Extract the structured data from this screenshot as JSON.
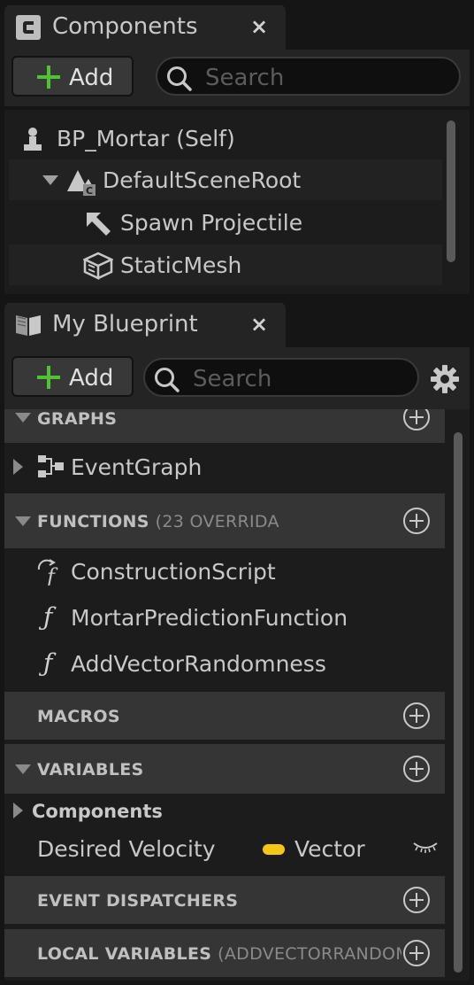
{
  "components_panel": {
    "tab_title": "Components",
    "close_glyph": "×",
    "add_label": "Add",
    "search_placeholder": "Search",
    "tree": [
      {
        "label": "BP_Mortar (Self)",
        "icon": "pawn-icon"
      },
      {
        "label": "DefaultSceneRoot",
        "icon": "scene-root-icon",
        "expanded": true
      },
      {
        "label": "Spawn Projectile",
        "icon": "arrow-component-icon"
      },
      {
        "label": "StaticMesh",
        "icon": "static-mesh-icon"
      }
    ]
  },
  "blueprint_panel": {
    "tab_title": "My Blueprint",
    "close_glyph": "×",
    "add_label": "Add",
    "search_placeholder": "Search",
    "sections": {
      "graphs": {
        "title": "GRAPHS",
        "items": [
          "EventGraph"
        ]
      },
      "functions": {
        "title": "FUNCTIONS",
        "subtitle": "(23 OVERRIDA",
        "items": [
          "ConstructionScript",
          "MortarPredictionFunction",
          "AddVectorRandomness"
        ]
      },
      "macros": {
        "title": "MACROS"
      },
      "variables": {
        "title": "VARIABLES",
        "category": "Components",
        "items": [
          {
            "name": "Desired Velocity",
            "type": "Vector",
            "type_color": "#f5c518"
          }
        ]
      },
      "event_dispatchers": {
        "title": "EVENT DISPATCHERS"
      },
      "local_variables": {
        "title": "LOCAL VARIABLES",
        "subtitle": "(ADDVECTORRANDOMN"
      }
    }
  },
  "colors": {
    "accent_add": "#4fc236",
    "vector_pin": "#f5c518"
  }
}
